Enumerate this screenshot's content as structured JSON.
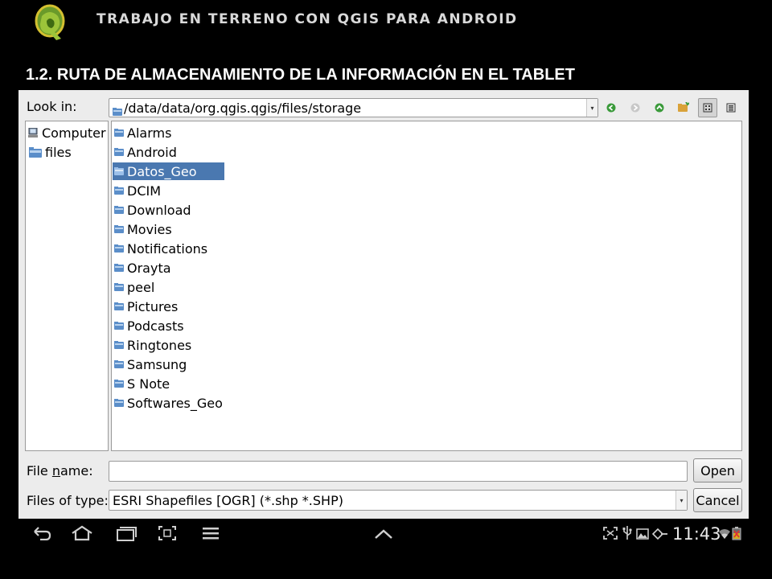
{
  "slide": {
    "title": "TRABAJO EN TERRENO CON QGIS PARA ANDROID",
    "section_title": "1.2.  RUTA DE ALMACENAMIENTO DE LA INFORMACIÓN EN EL TABLET"
  },
  "dialog": {
    "look_in_label": "Look in:",
    "path": "/data/data/org.qgis.qgis/files/storage",
    "toolbar": [
      {
        "name": "back-icon"
      },
      {
        "name": "forward-icon"
      },
      {
        "name": "parent-directory-icon"
      },
      {
        "name": "new-folder-icon"
      },
      {
        "name": "list-view-icon",
        "pressed": true
      },
      {
        "name": "detail-view-icon"
      }
    ],
    "sidebar": [
      {
        "label": "Computer",
        "icon": "computer-icon"
      },
      {
        "label": "files",
        "icon": "folder-icon"
      }
    ],
    "files": [
      {
        "label": "Alarms"
      },
      {
        "label": "Android"
      },
      {
        "label": "Datos_Geo",
        "selected": true
      },
      {
        "label": "DCIM"
      },
      {
        "label": "Download"
      },
      {
        "label": "Movies"
      },
      {
        "label": "Notifications"
      },
      {
        "label": "Orayta"
      },
      {
        "label": "peel"
      },
      {
        "label": "Pictures"
      },
      {
        "label": "Podcasts"
      },
      {
        "label": "Ringtones"
      },
      {
        "label": "Samsung"
      },
      {
        "label": "S Note"
      },
      {
        "label": "Softwares_Geo"
      }
    ],
    "file_name_label_pre": "File ",
    "file_name_label_u": "n",
    "file_name_label_post": "ame:",
    "file_name_value": "",
    "file_type_label": "Files of type:",
    "file_type_value": "ESRI Shapefiles [OGR] (*.shp *.SHP)",
    "open_button": "Open",
    "cancel_button": "Cancel"
  },
  "statusbar": {
    "time": "11:43",
    "icons": [
      "screenshot-icon",
      "usb-icon",
      "image-icon",
      "debug-icon",
      "wifi-icon",
      "battery-icon"
    ]
  },
  "navbar": {
    "icons": [
      "back-icon",
      "home-icon",
      "recent-apps-icon",
      "screenshot-icon",
      "menu-icon",
      "chevron-up-icon"
    ]
  },
  "colors": {
    "selection": "#4a78b0",
    "dialog_bg": "#ececec",
    "folder_blue": "#5b8ec9"
  }
}
